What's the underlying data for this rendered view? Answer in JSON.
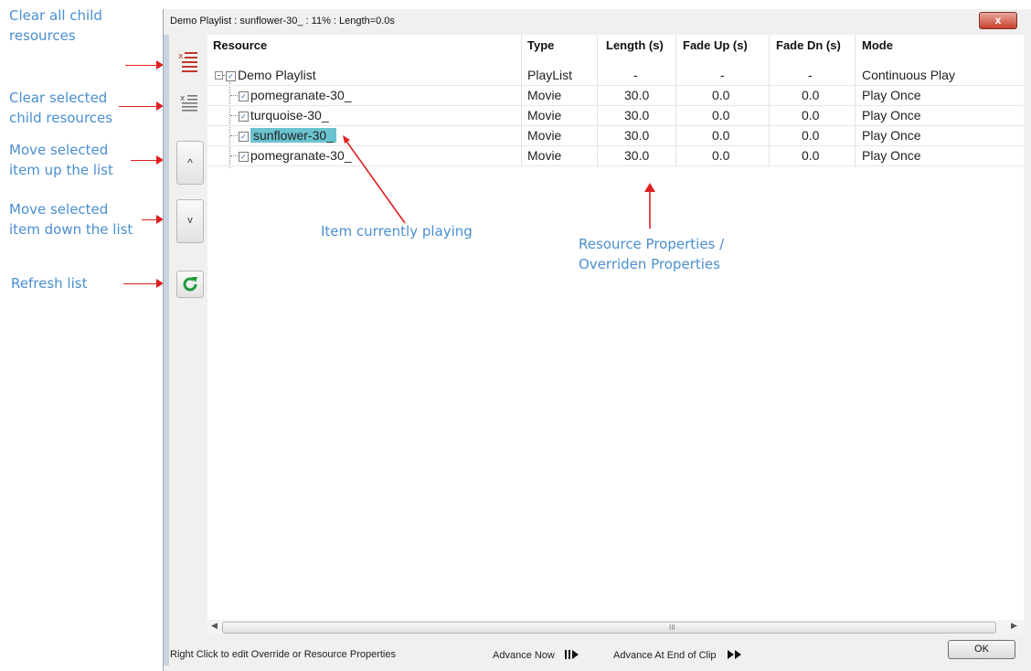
{
  "annotations": {
    "clear_all": [
      "Clear all child",
      "resources"
    ],
    "clear_selected": [
      "Clear selected",
      "child resources"
    ],
    "move_up": [
      "Move selected",
      "item up the list"
    ],
    "move_down": [
      "Move selected",
      "item down the list"
    ],
    "refresh": "Refresh list",
    "currently_playing": "Item currently playing",
    "resource_props": [
      "Resource Properties /",
      "Overriden Properties"
    ]
  },
  "window": {
    "title": "Demo Playlist : sunflower-30_ : 11% : Length=0.0s",
    "close_glyph": "x"
  },
  "toolbar": {
    "up_glyph": "^",
    "down_glyph": "v"
  },
  "columns": [
    "Resource",
    "Type",
    "Length (s)",
    "Fade Up (s)",
    "Fade Dn (s)",
    "Mode"
  ],
  "rows": [
    {
      "resource": "Demo Playlist",
      "type": "PlayList",
      "length": "-",
      "fade_up": "-",
      "fade_dn": "-",
      "mode": "Continuous Play"
    },
    {
      "resource": "pomegranate-30_",
      "type": "Movie",
      "length": "30.0",
      "fade_up": "0.0",
      "fade_dn": "0.0",
      "mode": "Play Once"
    },
    {
      "resource": "turquoise-30_",
      "type": "Movie",
      "length": "30.0",
      "fade_up": "0.0",
      "fade_dn": "0.0",
      "mode": "Play Once"
    },
    {
      "resource": "sunflower-30_",
      "type": "Movie",
      "length": "30.0",
      "fade_up": "0.0",
      "fade_dn": "0.0",
      "mode": "Play Once"
    },
    {
      "resource": "pomegranate-30_",
      "type": "Movie",
      "length": "30.0",
      "fade_up": "0.0",
      "fade_dn": "0.0",
      "mode": "Play Once"
    }
  ],
  "checkbox_glyph": "✓",
  "expander_glyph": "−",
  "scrollbar": {
    "grip": "III",
    "left_arrow": "◀",
    "right_arrow": "▶"
  },
  "status": {
    "hint": "Right Click to edit Override or Resource Properties",
    "advance_now": "Advance Now",
    "advance_end": "Advance At End of Clip"
  },
  "ok_label": "OK",
  "colors": {
    "annotation_blue": "#4a8fd0",
    "annotation_red": "#e02020",
    "selection": "#6ac3cf"
  }
}
